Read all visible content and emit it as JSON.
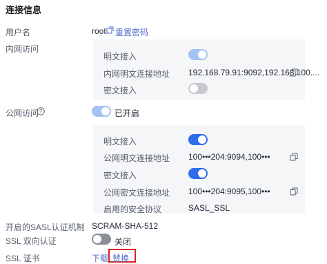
{
  "section_title": "连接信息",
  "username": {
    "label": "用户名",
    "value": "root",
    "reset_label": "重置密码"
  },
  "intranet": {
    "label": "内网访问",
    "plain_access_label": "明文接入",
    "plain_address_label": "内网明文连接地址",
    "plain_address_value": "192.168.79.91:9092,192.168.100....",
    "cipher_access_label": "密文接入"
  },
  "public": {
    "label": "公网访问",
    "toggle_text": "已开启",
    "plain_access_label": "明文接入",
    "plain_address_label": "公网明文连接地址",
    "plain_address_value": "100•••204:9094,100•••",
    "cipher_access_label": "密文接入",
    "cipher_address_label": "公网密文连接地址",
    "cipher_address_value": "100•••204:9095,100•••",
    "protocol_label": "启用的安全协议",
    "protocol_value": "SASL_SSL"
  },
  "sasl": {
    "label": "开启的SASL认证机制",
    "value": "SCRAM-SHA-512"
  },
  "ssl_mutual": {
    "label": "SSL 双向认证",
    "toggle_text": "关闭"
  },
  "ssl_cert": {
    "label": "SSL 证书",
    "download_label": "下载",
    "separator": "|",
    "replace_label": "替换"
  },
  "icons": {
    "copy": "copy-icon",
    "help": "help-circle-icon"
  },
  "colors": {
    "accent": "#2f6dea",
    "link": "#526ecc",
    "highlight": "#e02020",
    "panel": "#f5f6f7"
  }
}
